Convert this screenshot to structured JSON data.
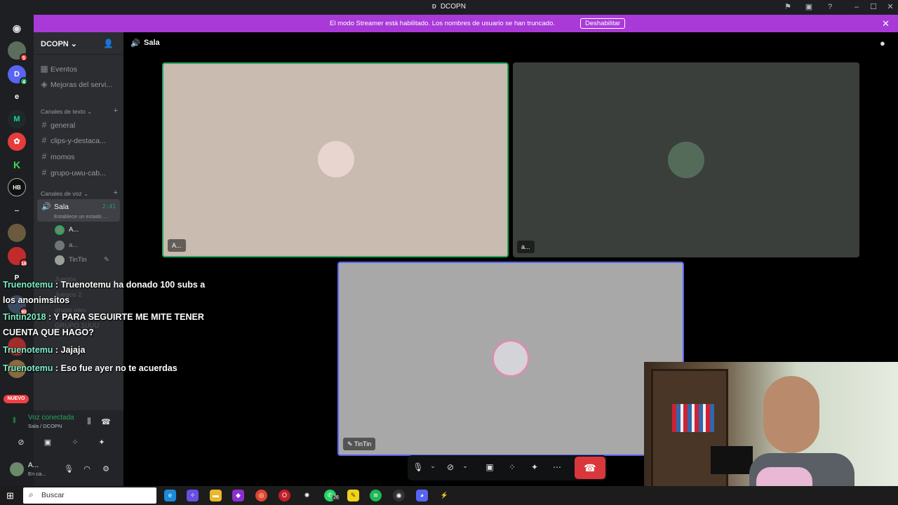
{
  "window": {
    "app_letter": "D",
    "title": "DCOPN"
  },
  "banner": {
    "message": "El modo Streamer está habilitado. Los nombres de usuario se han truncado.",
    "button": "Deshabilitar"
  },
  "guilds": {
    "badges": [
      "5",
      "4",
      "16",
      "90"
    ],
    "letters": [
      "D",
      "e",
      "P"
    ],
    "new_label": "NUEVO",
    "separator": "--"
  },
  "server": {
    "name": "DCOPN ⌄"
  },
  "channels": {
    "events": "Eventos",
    "boosts": "Mejoras del servi...",
    "text_category": "Canales de texto ⌄",
    "text": [
      "general",
      "clips-y-destaca...",
      "momos",
      "grupo-uwu-cab..."
    ],
    "voice_category": "Canales de voz ⌄",
    "voice_channel": "Sala",
    "voice_time": "2:41",
    "voice_status": "Establece un estado ...",
    "voice_users": [
      "A...",
      "a...",
      "TinTin"
    ],
    "faded": [
      "Juegos",
      "Juegos 2",
      "grupo uwu",
      "GRUPO 1UUU"
    ]
  },
  "user_panel": {
    "connected": "Voz conectada",
    "location": "Sala / DCOPN",
    "username": "A...",
    "status": "En ca..."
  },
  "stage": {
    "header": "Sala",
    "tiles": [
      {
        "label": "A...",
        "bg": "#c9bbb0",
        "avatar_color": "#e8d5d0",
        "speaking": true
      },
      {
        "label": "a...",
        "bg": "#3b3f3b",
        "avatar_color": "#556b5a",
        "speaking": false
      },
      {
        "label": "TinTin",
        "bg": "#a8a8a8",
        "avatar_color": "#d4d4d8",
        "speaking": false
      }
    ]
  },
  "chat": [
    {
      "user": "Truenotemu",
      "text": " : Truenotemu ha donado 100 subs a los anonimsitos"
    },
    {
      "user": "Tintin2018",
      "text": " : Y PARA SEGUIRTE ME MITE TENER CUENTA QUE HAGO?"
    },
    {
      "user": "Truenotemu",
      "text": " : Jajaja"
    },
    {
      "user": "Truenotemu",
      "text": " : Eso fue ayer no te acuerdas"
    }
  ],
  "taskbar": {
    "search": "Buscar",
    "whatsapp_badge": "26"
  },
  "colors": {
    "accent": "#a93ad8",
    "online": "#23a55a",
    "danger": "#da373c",
    "chat_user": "#7ef0c9"
  }
}
